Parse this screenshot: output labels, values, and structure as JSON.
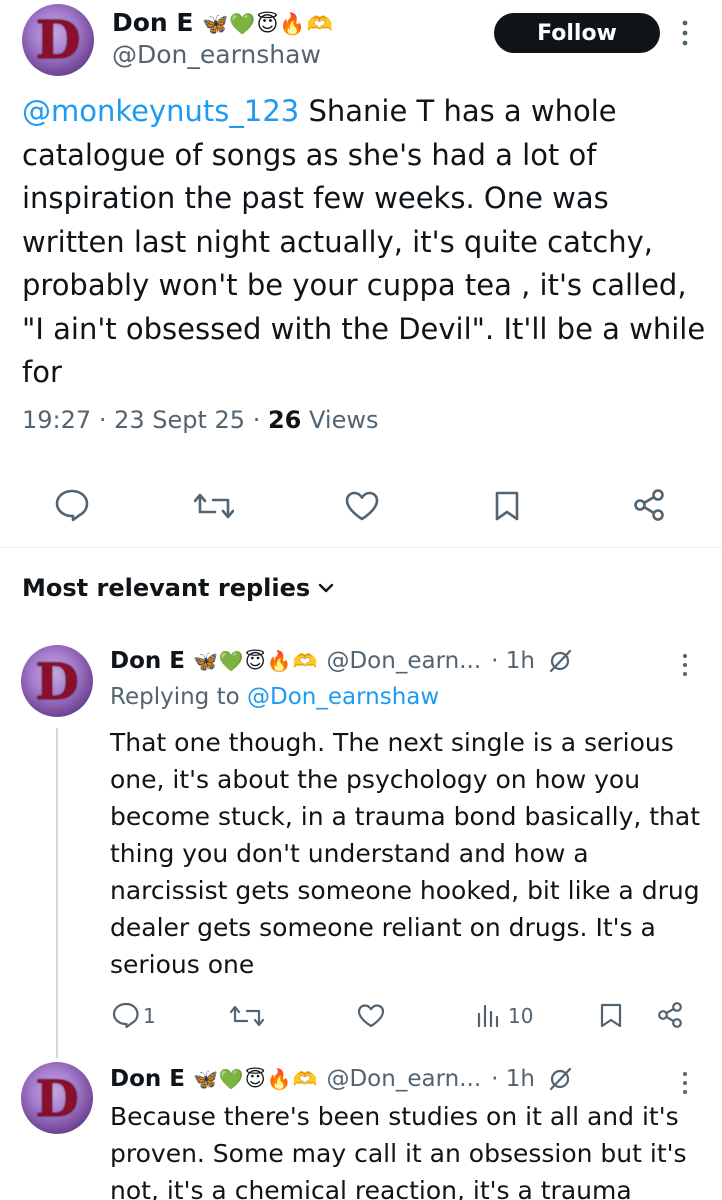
{
  "main_tweet": {
    "author_name": "Don E",
    "author_emojis": "🦋💚😇🔥🫶",
    "author_handle": "@Don_earnshaw",
    "follow_label": "Follow",
    "mention": "@monkeynuts_123",
    "text": " Shanie T has a whole catalogue of songs as she's had a lot of inspiration the past few weeks. One was written last night actually, it's quite catchy, probably won't be your cuppa tea , it's called, \"I ain't obsessed with the Devil\". It'll be a while for",
    "time": "19:27",
    "date": "23 Sept 25",
    "views_count": "26",
    "views_label": "Views",
    "avatar_letter": "D"
  },
  "replies_sort_label": "Most relevant replies",
  "replies": [
    {
      "author_name": "Don E",
      "author_emojis": "🦋💚😇🔥🫶",
      "author_handle": "@Don_earn...",
      "age": "· 1h",
      "replying_prefix": "Replying to ",
      "replying_to": "@Don_earnshaw",
      "text": "That one though. The next single is a serious one, it's about the psychology on how you become stuck, in a trauma bond basically, that thing you don't understand and how a narcissist gets someone hooked, bit like a drug dealer gets someone reliant on drugs. It's a serious one",
      "reply_count": "1",
      "view_count": "10",
      "avatar_letter": "D"
    },
    {
      "author_name": "Don E",
      "author_emojis": "🦋💚😇🔥🫶",
      "author_handle": "@Don_earn...",
      "age": "· 1h",
      "text": "Because there's been studies on it all and it's proven. Some may call it an obsession but it's not, it's a chemical reaction, it's a trauma",
      "avatar_letter": "D"
    }
  ],
  "icons": {
    "reply": "comment-icon",
    "retweet": "repost-icon",
    "like": "heart-icon",
    "bookmark": "bookmark-icon",
    "share": "share-icon",
    "views": "analytics-icon",
    "grok": "grok-icon",
    "more": "more-vertical-icon",
    "chevron": "chevron-down-icon"
  },
  "colors": {
    "link": "#1d9bf0",
    "muted": "#536471",
    "text": "#0f1419",
    "follow_bg": "#0f1419"
  }
}
